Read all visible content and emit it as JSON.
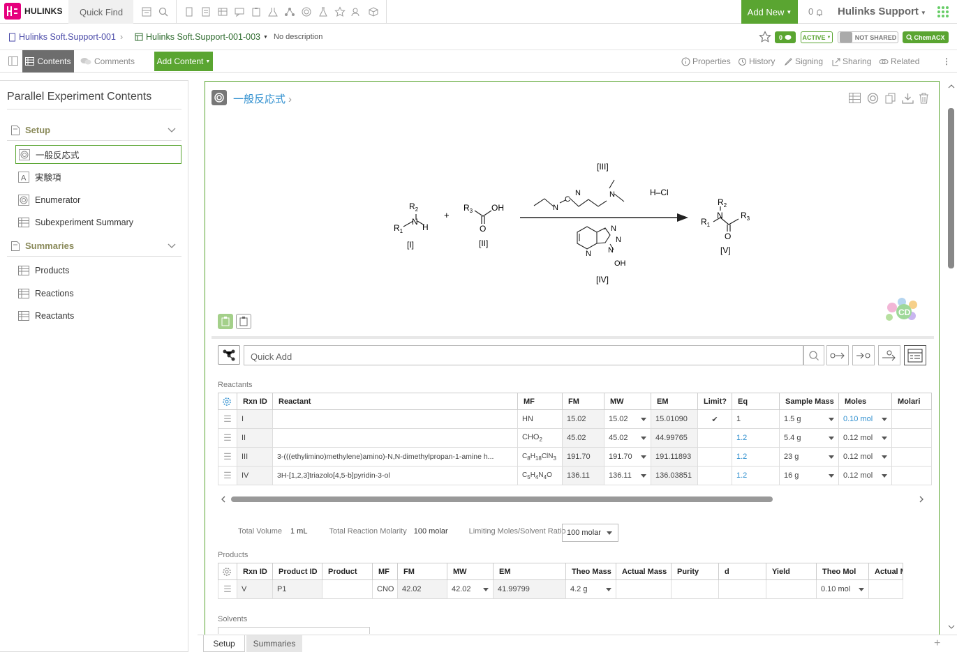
{
  "app": {
    "logo_text": "HULINKS",
    "quick_find": "Quick Find",
    "add_new": "Add New",
    "notifications": "0",
    "user": "Hulinks Support"
  },
  "breadcrumb": {
    "notebook": "Hulinks Soft.Support-001",
    "experiment": "Hulinks Soft.Support-001-003",
    "description": "No description"
  },
  "status": {
    "comments": "0",
    "state": "ACTIVE",
    "shared": "NOT SHARED",
    "chemacx": "ChemACX"
  },
  "toolbar": {
    "contents": "Contents",
    "comments": "Comments",
    "add_content": "Add Content",
    "properties": "Properties",
    "history": "History",
    "signing": "Signing",
    "sharing": "Sharing",
    "related": "Related"
  },
  "left_panel": {
    "title": "Parallel Experiment Contents",
    "setup": {
      "label": "Setup",
      "items": [
        "一般反応式",
        "実験項",
        "Enumerator",
        "Subexperiment Summary"
      ]
    },
    "summaries": {
      "label": "Summaries",
      "items": [
        "Products",
        "Reactions",
        "Reactants"
      ]
    }
  },
  "section": {
    "title": "一般反応式"
  },
  "scheme": {
    "labels": [
      "[I]",
      "[II]",
      "[III]",
      "[IV]",
      "[V]"
    ],
    "hcl": "H–Cl"
  },
  "quick_add": {
    "placeholder": "Quick Add"
  },
  "reactants": {
    "label": "Reactants",
    "headers": [
      "Rxn ID",
      "Reactant",
      "MF",
      "FM",
      "MW",
      "EM",
      "Limit?",
      "Eq",
      "Sample Mass",
      "Moles",
      "Molari"
    ],
    "rows": [
      {
        "rxn": "I",
        "name": "",
        "mf": "HN",
        "fm": "15.02",
        "mw": "15.02",
        "em": "15.01090",
        "limit": "✔",
        "eq": "1",
        "mass": "1.5 g",
        "moles": "0.10 mol"
      },
      {
        "rxn": "II",
        "name": "",
        "mf": "CHO2",
        "fm": "45.02",
        "mw": "45.02",
        "em": "44.99765",
        "limit": "",
        "eq": "1.2",
        "mass": "5.4 g",
        "moles": "0.12 mol"
      },
      {
        "rxn": "III",
        "name": "3-(((ethylimino)methylene)amino)-N,N-dimethylpropan-1-amine h...",
        "mf": "C8H18ClN3",
        "fm": "191.70",
        "mw": "191.70",
        "em": "191.11893",
        "limit": "",
        "eq": "1.2",
        "mass": "23 g",
        "moles": "0.12 mol"
      },
      {
        "rxn": "IV",
        "name": "3H-[1,2,3]triazolo[4,5-b]pyridin-3-ol",
        "mf": "C5H4N4O",
        "fm": "136.11",
        "mw": "136.11",
        "em": "136.03851",
        "limit": "",
        "eq": "1.2",
        "mass": "16 g",
        "moles": "0.12 mol"
      }
    ]
  },
  "totals": {
    "volume_label": "Total Volume",
    "volume": "1 mL",
    "molarity_label": "Total Reaction Molarity",
    "molarity": "100 molar",
    "ratio_label": "Limiting Moles/Solvent Ratio",
    "ratio": "100 molar"
  },
  "products": {
    "label": "Products",
    "headers": [
      "Rxn ID",
      "Product ID",
      "Product",
      "MF",
      "FM",
      "MW",
      "EM",
      "Theo Mass",
      "Actual Mass",
      "Purity",
      "d",
      "Yield",
      "Theo Mol",
      "Actual Mol"
    ],
    "rows": [
      {
        "rxn": "V",
        "pid": "P1",
        "product": "",
        "mf": "CNO",
        "fm": "42.02",
        "mw": "42.02",
        "em": "41.99799",
        "theo_mass": "4.2 g",
        "actual_mass": "",
        "purity": "",
        "d": "",
        "yield": "",
        "theo_mol": "0.10 mol",
        "actual_mol": ""
      }
    ]
  },
  "solvents": {
    "label": "Solvents"
  },
  "tabs": {
    "setup": "Setup",
    "summaries": "Summaries"
  },
  "colors": {
    "brand_green": "#5aa531",
    "link_blue": "#2f8fcf",
    "logo_pink": "#e6007e"
  }
}
